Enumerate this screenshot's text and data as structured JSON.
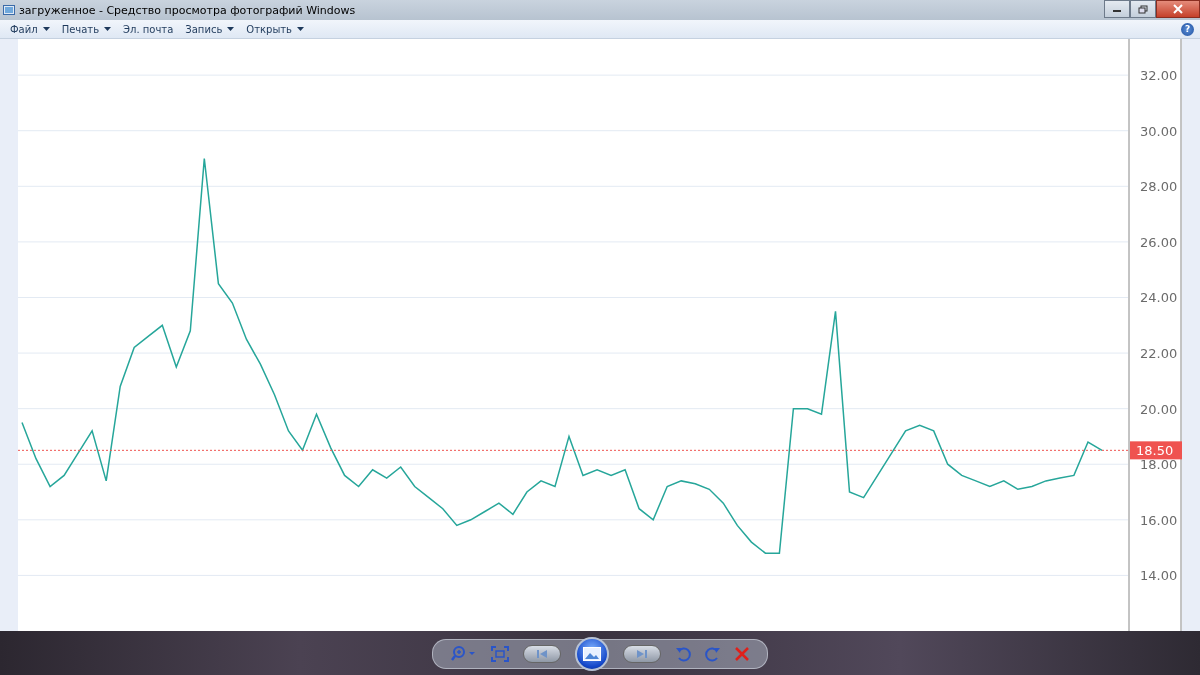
{
  "window": {
    "title": "загруженное - Средство просмотра фотографий Windows"
  },
  "menu": [
    {
      "label": "Файл",
      "dropdown": true
    },
    {
      "label": "Печать",
      "dropdown": true
    },
    {
      "label": "Эл. почта",
      "dropdown": false
    },
    {
      "label": "Запись",
      "dropdown": true
    },
    {
      "label": "Открыть",
      "dropdown": true
    }
  ],
  "help": "?",
  "image": {
    "chart_data": {
      "type": "line",
      "ylim": [
        12,
        33.3
      ],
      "yticks": [
        {
          "value": 14,
          "label": "14.00"
        },
        {
          "value": 16,
          "label": "16.00"
        },
        {
          "value": 18,
          "label": "18.00"
        },
        {
          "value": 20,
          "label": "20.00"
        },
        {
          "value": 22,
          "label": "22.00"
        },
        {
          "value": 24,
          "label": "24.00"
        },
        {
          "value": 26,
          "label": "26.00"
        },
        {
          "value": 28,
          "label": "28.00"
        },
        {
          "value": 30,
          "label": "30.00"
        },
        {
          "value": 32,
          "label": "32.00"
        }
      ],
      "grid": true,
      "series": [
        {
          "color": "#26a69a",
          "values": [
            19.5,
            18.2,
            17.2,
            17.6,
            18.4,
            19.2,
            17.4,
            20.8,
            22.2,
            22.6,
            23,
            21.5,
            22.8,
            29,
            24.5,
            23.8,
            22.5,
            21.6,
            20.5,
            19.2,
            18.5,
            19.8,
            18.6,
            17.6,
            17.2,
            17.8,
            17.5,
            17.9,
            17.2,
            16.8,
            16.4,
            15.8,
            16,
            16.3,
            16.6,
            16.2,
            17,
            17.4,
            17.2,
            19,
            17.6,
            17.8,
            17.6,
            17.8,
            16.4,
            16,
            17.2,
            17.4,
            17.3,
            17.1,
            16.6,
            15.8,
            15.2,
            14.8,
            14.8,
            20,
            20,
            19.8,
            23.5,
            17,
            16.8,
            17.6,
            18.4,
            19.2,
            19.4,
            19.2,
            18,
            17.6,
            17.4,
            17.2,
            17.4,
            17.1,
            17.2,
            17.4,
            17.5,
            17.6,
            18.8,
            18.5
          ]
        }
      ],
      "ref_lines": [
        {
          "axis": "y",
          "value": 18.5,
          "label": "18.50"
        }
      ]
    }
  },
  "toolbar": [
    {
      "kind": "zoom"
    },
    {
      "kind": "fit"
    },
    {
      "kind": "prev"
    },
    {
      "kind": "slideshow"
    },
    {
      "kind": "next"
    },
    {
      "kind": "rotate_left"
    },
    {
      "kind": "rotate_right"
    },
    {
      "kind": "delete"
    }
  ]
}
